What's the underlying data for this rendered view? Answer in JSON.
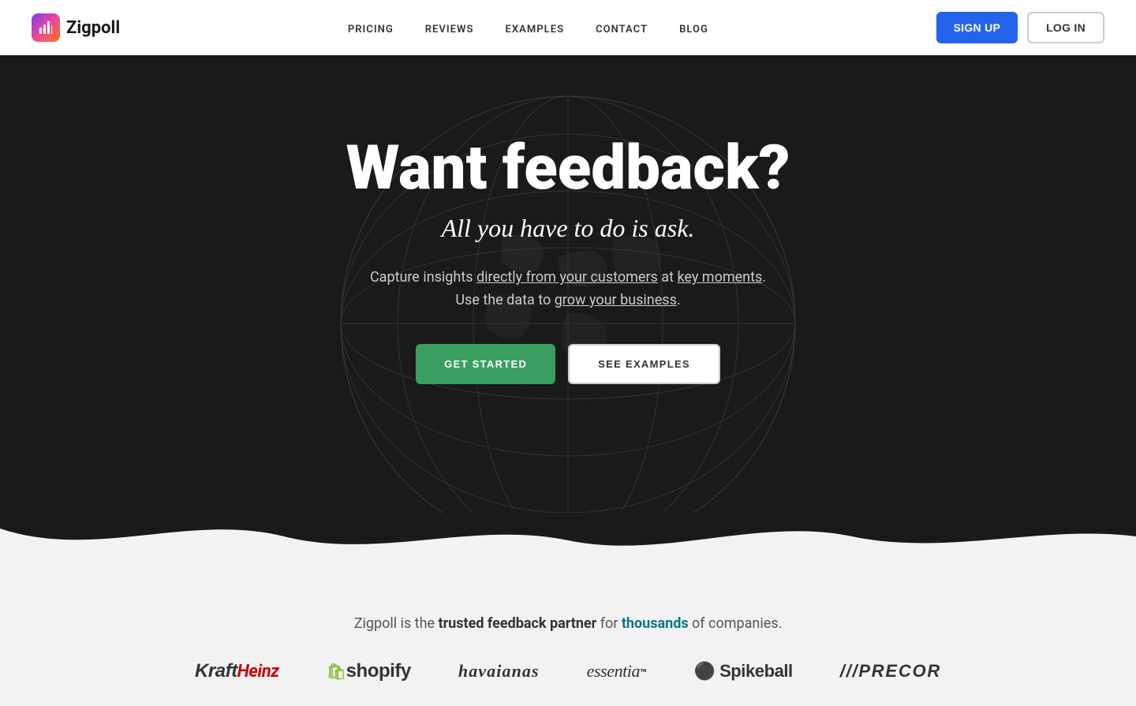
{
  "nav": {
    "logo_text": "Zigpoll",
    "links": [
      {
        "label": "PRICING",
        "id": "pricing"
      },
      {
        "label": "REVIEWS",
        "id": "reviews"
      },
      {
        "label": "EXAMPLES",
        "id": "examples"
      },
      {
        "label": "CONTACT",
        "id": "contact"
      },
      {
        "label": "BLOG",
        "id": "blog"
      }
    ],
    "signup_label": "SIGN UP",
    "login_label": "LOG IN"
  },
  "hero": {
    "title": "Want feedback?",
    "subtitle": "All you have to do is ask.",
    "description_part1": "Capture insights ",
    "description_link1": "directly from your customers",
    "description_part2": " at ",
    "description_link2": "key moments",
    "description_part3": ". Use the data to ",
    "description_link3": "grow your business",
    "description_part4": ".",
    "cta_primary": "GET STARTED",
    "cta_secondary": "SEE EXAMPLES"
  },
  "logos_section": {
    "tagline_part1": "Zigpoll is the ",
    "tagline_bold": "trusted feedback partner",
    "tagline_part2": " for ",
    "tagline_thousands": "thousands",
    "tagline_part3": " of companies.",
    "brands": [
      {
        "name": "KraftHeinz",
        "id": "kraft"
      },
      {
        "name": "shopify",
        "id": "shopify"
      },
      {
        "name": "havaianas",
        "id": "havaianas"
      },
      {
        "name": "essentia",
        "id": "essentia"
      },
      {
        "name": "Spikeball",
        "id": "spikeball"
      },
      {
        "name": "PRECOR",
        "id": "precor"
      }
    ]
  }
}
